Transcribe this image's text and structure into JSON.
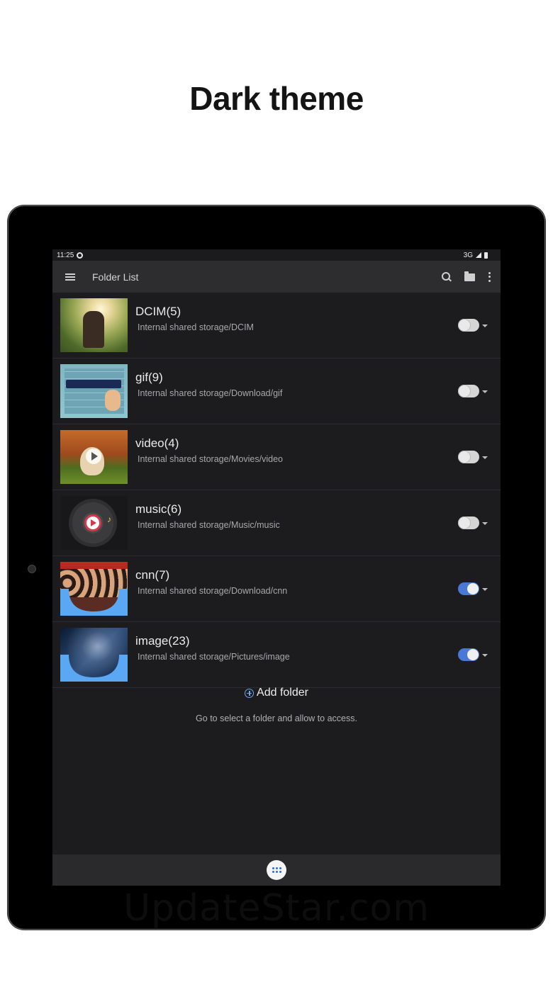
{
  "heading": "Dark theme",
  "status_bar": {
    "time": "11:25",
    "network": "3G"
  },
  "app_bar": {
    "title": "Folder List"
  },
  "folders": [
    {
      "name": "DCIM(5)",
      "path": "Internal shared storage/DCIM",
      "enabled": false,
      "thumb": "dcim"
    },
    {
      "name": "gif(9)",
      "path": "Internal shared storage/Download/gif",
      "enabled": false,
      "thumb": "gif"
    },
    {
      "name": "video(4)",
      "path": "Internal shared storage/Movies/video",
      "enabled": false,
      "thumb": "video"
    },
    {
      "name": "music(6)",
      "path": "Internal shared storage/Music/music",
      "enabled": false,
      "thumb": "music"
    },
    {
      "name": "cnn(7)",
      "path": "Internal shared storage/Download/cnn",
      "enabled": true,
      "thumb": "cnn"
    },
    {
      "name": "image(23)",
      "path": "Internal shared storage/Pictures/image",
      "enabled": true,
      "thumb": "image"
    }
  ],
  "add_folder": {
    "label": "Add folder",
    "hint": "Go to select a folder and allow to access."
  },
  "watermark": "UpdateStar.com",
  "colors": {
    "background": "#1c1c1f",
    "app_bar": "#2d2d30",
    "toggle_on": "#4a78d6",
    "accent": "#6ea3f0"
  }
}
